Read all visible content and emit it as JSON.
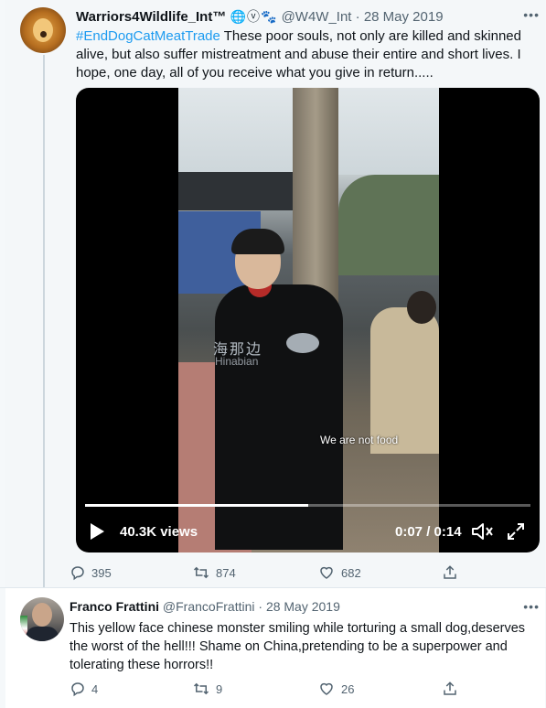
{
  "tweet1": {
    "author_name": "Warriors4Wildlife_Int™",
    "badges": "🌐ⓥ🐾",
    "handle": "@W4W_Int",
    "separator": "·",
    "date": "28 May 2019",
    "hashtag": "#EndDogCatMeatTrade",
    "body": " These poor souls, not only are killed and skinned alive, but also suffer mistreatment and abuse their entire and short lives. I hope, one day, all of you receive what you give in return.....",
    "more": "•••",
    "video": {
      "watermark_cn": "海那边",
      "watermark_en": "Hinabian",
      "caption": "We are not food",
      "views": "40.3K views",
      "time": "0:07 / 0:14",
      "progress": 0.5
    },
    "actions": {
      "replies": "395",
      "retweets": "874",
      "likes": "682"
    }
  },
  "tweet2": {
    "author_name": "Franco Frattini",
    "handle": "@FrancoFrattini",
    "separator": "·",
    "date": "28 May 2019",
    "more": "•••",
    "body": "This yellow face chinese monster smiling while torturing a small dog,deserves the worst of the hell!!!  Shame on China,pretending to be a superpower and tolerating these horrors!!",
    "actions": {
      "replies": "4",
      "retweets": "9",
      "likes": "26"
    }
  },
  "colors": {
    "link": "#1d9bf0",
    "secondary_text": "#536471",
    "thread_line": "#ccd6dd"
  }
}
